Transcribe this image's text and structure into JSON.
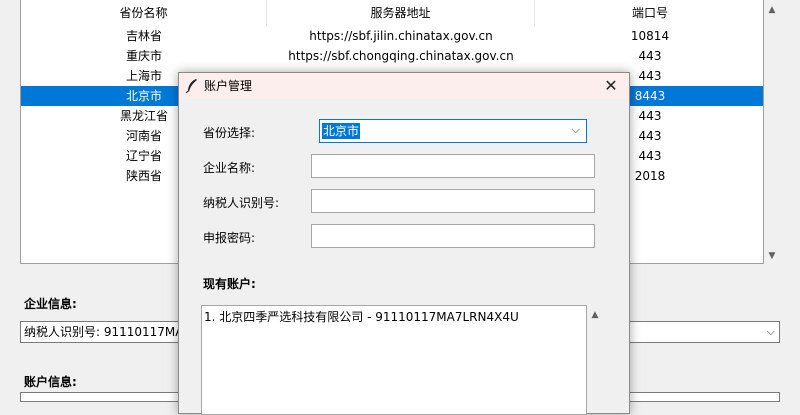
{
  "table": {
    "headers": [
      "省份名称",
      "服务器地址",
      "端口号"
    ],
    "rows": [
      {
        "province": "吉林省",
        "server": "https://sbf.jilin.chinatax.gov.cn",
        "port": "10814"
      },
      {
        "province": "重庆市",
        "server": "https://sbf.chongqing.chinatax.gov.cn",
        "port": "443"
      },
      {
        "province": "上海市",
        "server": "",
        "port": "443"
      },
      {
        "province": "北京市",
        "server": "",
        "port": "8443"
      },
      {
        "province": "黑龙江省",
        "server": "",
        "port": "443"
      },
      {
        "province": "河南省",
        "server": "",
        "port": "443"
      },
      {
        "province": "辽宁省",
        "server": "",
        "port": "443"
      },
      {
        "province": "陕西省",
        "server": "",
        "port": "2018"
      }
    ],
    "selected_row": 3
  },
  "main": {
    "enterprise_label": "企业信息:",
    "enterprise_value": "纳税人识别号: 91110117MA",
    "account_label": "账户信息:"
  },
  "dialog": {
    "title": "账户管理",
    "close_glyph": "✕",
    "province_label": "省份选择:",
    "province_value": "北京市",
    "company_label": "企业名称:",
    "company_value": "",
    "taxid_label": "纳税人识别号:",
    "taxid_value": "",
    "password_label": "申报密码:",
    "password_value": "",
    "existing_label": "现有账户:",
    "accounts": [
      "1. 北京四季严选科技有限公司 - 91110117MA7LRN4X4U"
    ]
  },
  "icons": {
    "scroll_up": "▲",
    "scroll_down": "▼",
    "dropdown": "⌵"
  },
  "colors": {
    "selection": "#0078d7",
    "titlebar": "#fbeeec"
  }
}
